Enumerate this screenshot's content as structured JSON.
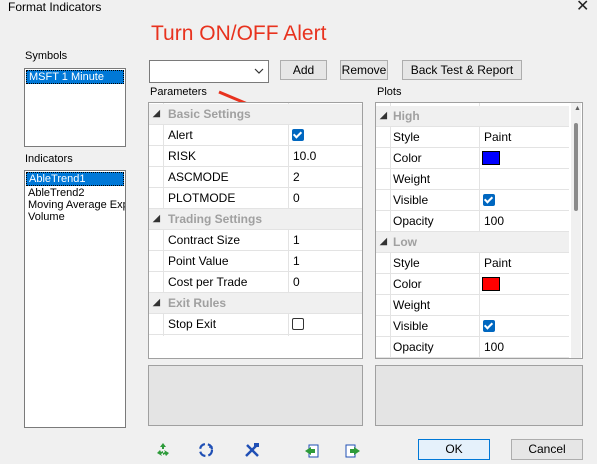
{
  "window": {
    "title": "Format Indicators"
  },
  "annotation": "Turn ON/OFF Alert",
  "symbols": {
    "label": "Symbols",
    "items": [
      "MSFT 1 Minute"
    ]
  },
  "indicators": {
    "label": "Indicators",
    "items": [
      "AbleTrend1",
      "AbleTrend2",
      "Moving Average Exp",
      "Volume"
    ]
  },
  "toolbar": {
    "dropdown_value": "",
    "add_label": "Add",
    "remove_label": "Remove",
    "backtest_label": "Back Test & Report"
  },
  "parameters": {
    "label": "Parameters",
    "basic_settings": "Basic Settings",
    "alert": "Alert",
    "alert_checked": true,
    "risk": "RISK",
    "risk_value": "10.0",
    "ascmode": "ASCMODE",
    "ascmode_value": "2",
    "plotmode": "PLOTMODE",
    "plotmode_value": "0",
    "trading_settings": "Trading Settings",
    "contract_size": "Contract Size",
    "contract_size_value": "1",
    "point_value": "Point Value",
    "point_value_value": "1",
    "cost_per_trade": "Cost per Trade",
    "cost_per_trade_value": "0",
    "exit_rules": "Exit Rules",
    "stop_exit": "Stop Exit",
    "stop_exit_checked": false
  },
  "plots": {
    "label": "Plots",
    "high": {
      "name": "High",
      "style_label": "Style",
      "style": "Paint",
      "color_label": "Color",
      "color": "#0000ff",
      "weight_label": "Weight",
      "visible_label": "Visible",
      "visible": true,
      "opacity_label": "Opacity",
      "opacity": "100"
    },
    "low": {
      "name": "Low",
      "style_label": "Style",
      "style": "Paint",
      "color_label": "Color",
      "color": "#ff0000",
      "weight_label": "Weight",
      "visible_label": "Visible",
      "visible": true,
      "opacity_label": "Opacity",
      "opacity": "100"
    }
  },
  "footer": {
    "ok_label": "OK",
    "cancel_label": "Cancel"
  },
  "icons": [
    "recycle-green-icon",
    "recycle-blue-icon",
    "tools-icon",
    "import-icon",
    "export-icon"
  ]
}
